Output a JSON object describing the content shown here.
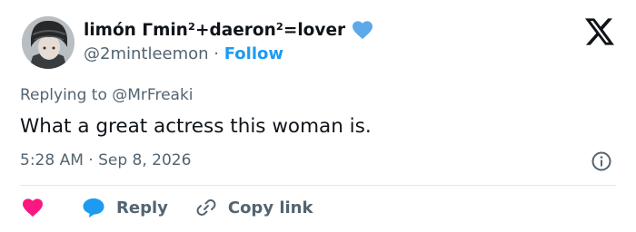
{
  "author": {
    "display_name": "limón Γmin²+daeron²=lover",
    "handle": "@2mintleemon",
    "separator": " · ",
    "follow_label": "Follow"
  },
  "reply_context": {
    "prefix": "Replying to ",
    "mention": "@MrFreaki"
  },
  "tweet": {
    "text": "What a great actress this woman is.",
    "timestamp": "5:28 AM · Sep 8, 2026"
  },
  "actions": {
    "reply_label": "Reply",
    "copy_label": "Copy link"
  },
  "icons": {
    "name_heart": "blue-heart-icon",
    "logo": "x-logo-icon",
    "info": "info-icon",
    "like": "red-heart-icon",
    "reply": "speech-bubble-icon",
    "copy": "link-icon"
  },
  "colors": {
    "accent": "#1d9bf0",
    "text": "#0f1419",
    "secondary": "#536471",
    "like": "#f91880",
    "divider": "#e1e8ed"
  }
}
